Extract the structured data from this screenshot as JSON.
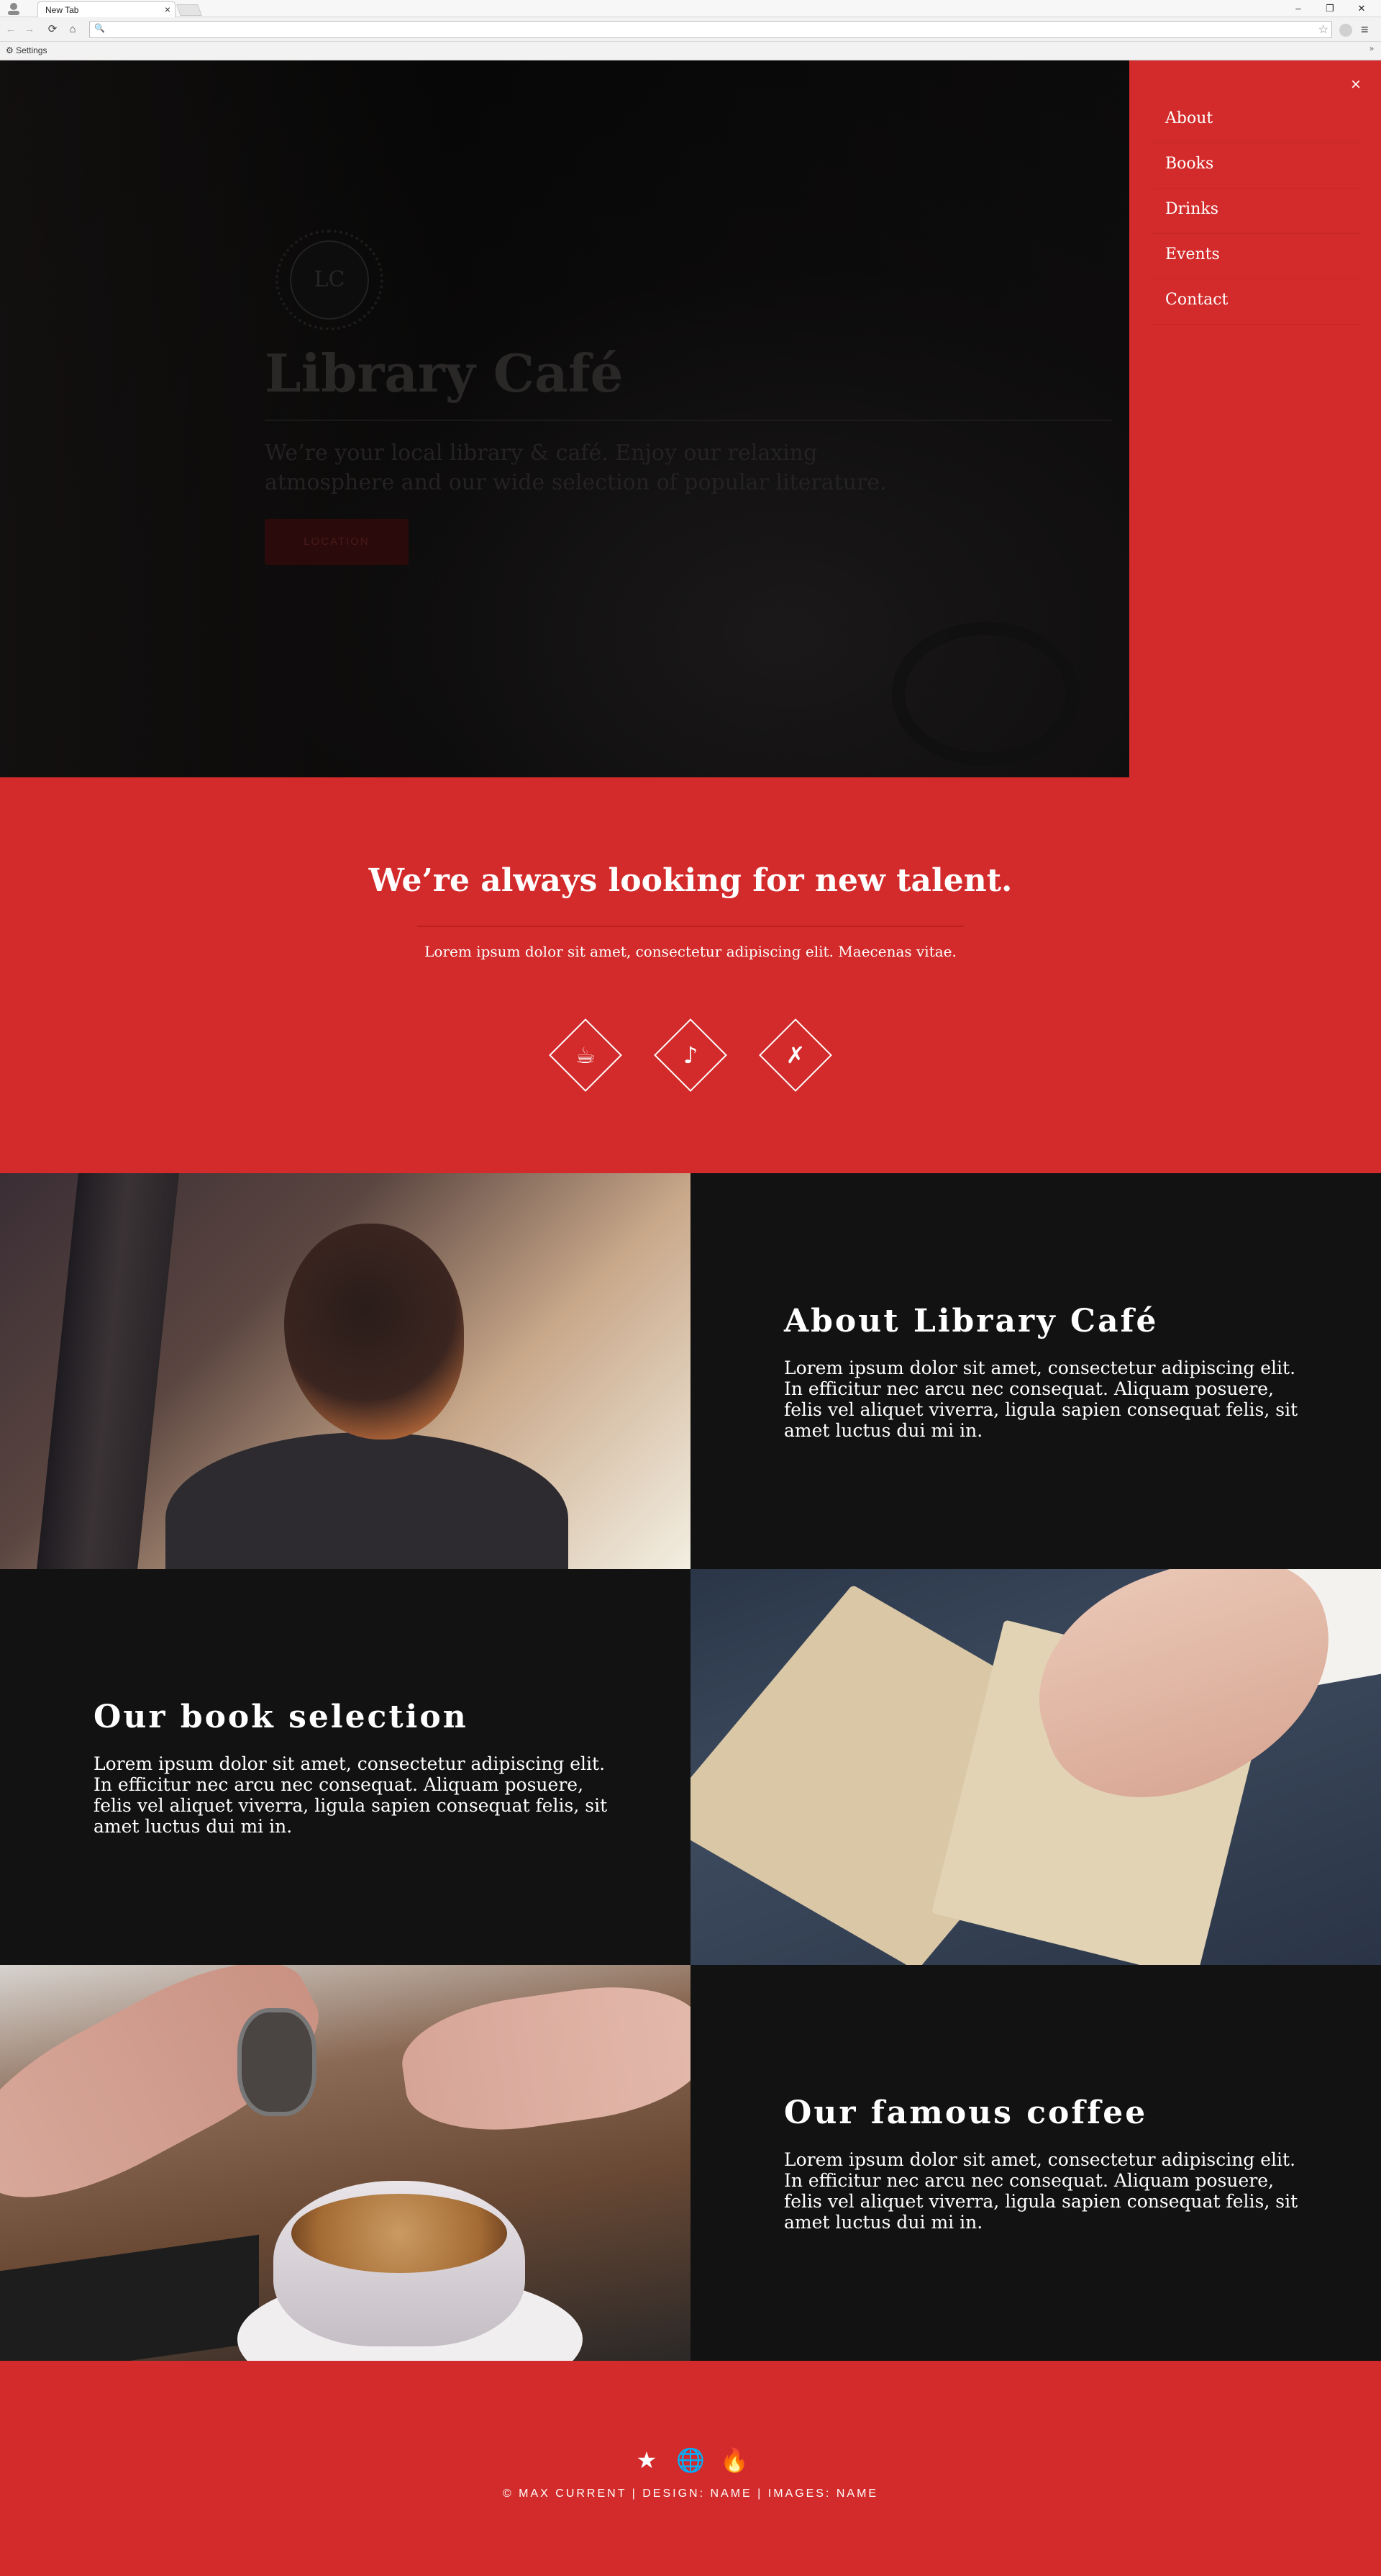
{
  "browser": {
    "tab_title": "New Tab",
    "tab_close": "×",
    "window_minimize": "–",
    "window_restore": "❐",
    "window_close": "✕",
    "back_glyph": "←",
    "forward_glyph": "→",
    "reload_glyph": "⟳",
    "home_glyph": "⌂",
    "search_glyph": "🔍",
    "address_value": "",
    "star_glyph": "☆",
    "menu_glyph": "≡",
    "bookmark_settings": "⚙ Settings",
    "bookmarks_more": "»"
  },
  "hero": {
    "logo_text": "LC",
    "title": "Library Café",
    "text": "We’re your local library & café. Enjoy our relaxing atmosphere and our wide selection of popular literature.",
    "button_label": "LOCATION"
  },
  "side_menu": {
    "close_glyph": "×",
    "items": [
      "About",
      "Books",
      "Drinks",
      "Events",
      "Contact"
    ]
  },
  "talent": {
    "title": "We’re always looking for new talent.",
    "text": "Lorem ipsum dolor sit amet, consectetur adipiscing elit. Maecenas vitae.",
    "icons": [
      "coffee-icon",
      "music-icon",
      "utensils-icon"
    ],
    "glyphs": [
      "☕",
      "♪",
      "✗"
    ]
  },
  "sections": [
    {
      "title": "About Library Café",
      "body": "Lorem ipsum dolor sit amet, consectetur adipiscing elit. In efficitur nec arcu nec consequat. Aliquam posuere, felis vel aliquet viverra, ligula sapien consequat felis, sit amet luctus dui mi in."
    },
    {
      "title": "Our book selection",
      "body": "Lorem ipsum dolor sit amet, consectetur adipiscing elit. In efficitur nec arcu nec consequat. Aliquam posuere, felis vel aliquet viverra, ligula sapien consequat felis, sit amet luctus dui mi in."
    },
    {
      "title": "Our famous coffee",
      "body": "Lorem ipsum dolor sit amet, consectetur adipiscing elit. In efficitur nec arcu nec consequat. Aliquam posuere, felis vel aliquet viverra, ligula sapien consequat felis, sit amet luctus dui mi in."
    }
  ],
  "footer": {
    "icons": [
      "star-icon",
      "globe-icon",
      "fire-icon"
    ],
    "glyphs": [
      "★",
      "🌐",
      "🔥"
    ],
    "credits": "© MAX CURRENT | DESIGN: NAME | IMAGES: NAME"
  },
  "colors": {
    "accent_red": "#d32b2b",
    "dark_panel": "#121212"
  }
}
